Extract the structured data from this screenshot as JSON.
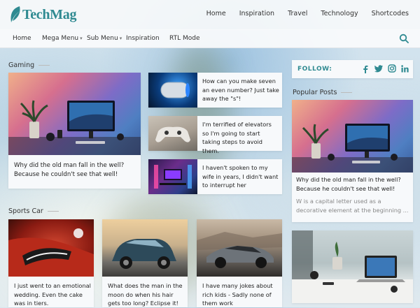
{
  "brand": {
    "logo_text": "TechMag",
    "accent": "#2f8a91"
  },
  "top_nav": [
    "Home",
    "Inspiration",
    "Travel",
    "Technology",
    "Shortcodes"
  ],
  "main_nav": {
    "home": "Home",
    "mega_menu": "Mega Menu",
    "sub_menu": "Sub Menu",
    "inspiration": "Inspiration",
    "rtl_mode": "RTL Mode"
  },
  "gaming": {
    "title": "Gaming",
    "featured": "Why did the old man fall in the well? Because he couldn't see that well!",
    "list": [
      "How can you make seven an even number? Just take away the \"s\"!",
      "I'm terrified of elevators so I'm going to start taking steps to avoid them.",
      "I haven't spoken to my wife in years, I didn't want to interrupt her"
    ]
  },
  "sports": {
    "title": "Sports Car",
    "posts": [
      "I just went to an emotional wedding. Even the cake was in tiers.",
      "What does the man in the moon do when his hair gets too long? Eclipse it!",
      "I have many jokes about rich kids - Sadly none of them work"
    ]
  },
  "sidebar": {
    "follow_label": "FOLLOW:",
    "social_icons": [
      "facebook-icon",
      "twitter-icon",
      "instagram-icon",
      "linkedin-icon"
    ],
    "popular_title": "Popular Posts",
    "popular_post": {
      "title": "Why did the old man fall in the well? Because he couldn't see that well!",
      "excerpt": "W is a capital letter used as a decorative element at the beginning ..."
    }
  }
}
